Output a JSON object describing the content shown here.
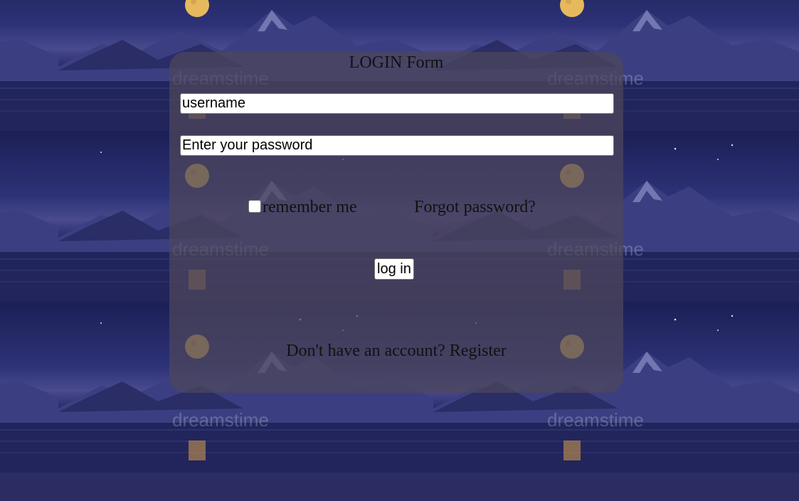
{
  "form": {
    "title": "LOGIN Form",
    "username_placeholder": "username",
    "password_placeholder": "Enter your password",
    "remember_label": "remember me",
    "forgot_label": "Forgot password?",
    "login_label": "log in",
    "no_account_text": "Don't have an account?",
    "register_label": "Register"
  },
  "background": {
    "watermark": "dreamstime"
  }
}
